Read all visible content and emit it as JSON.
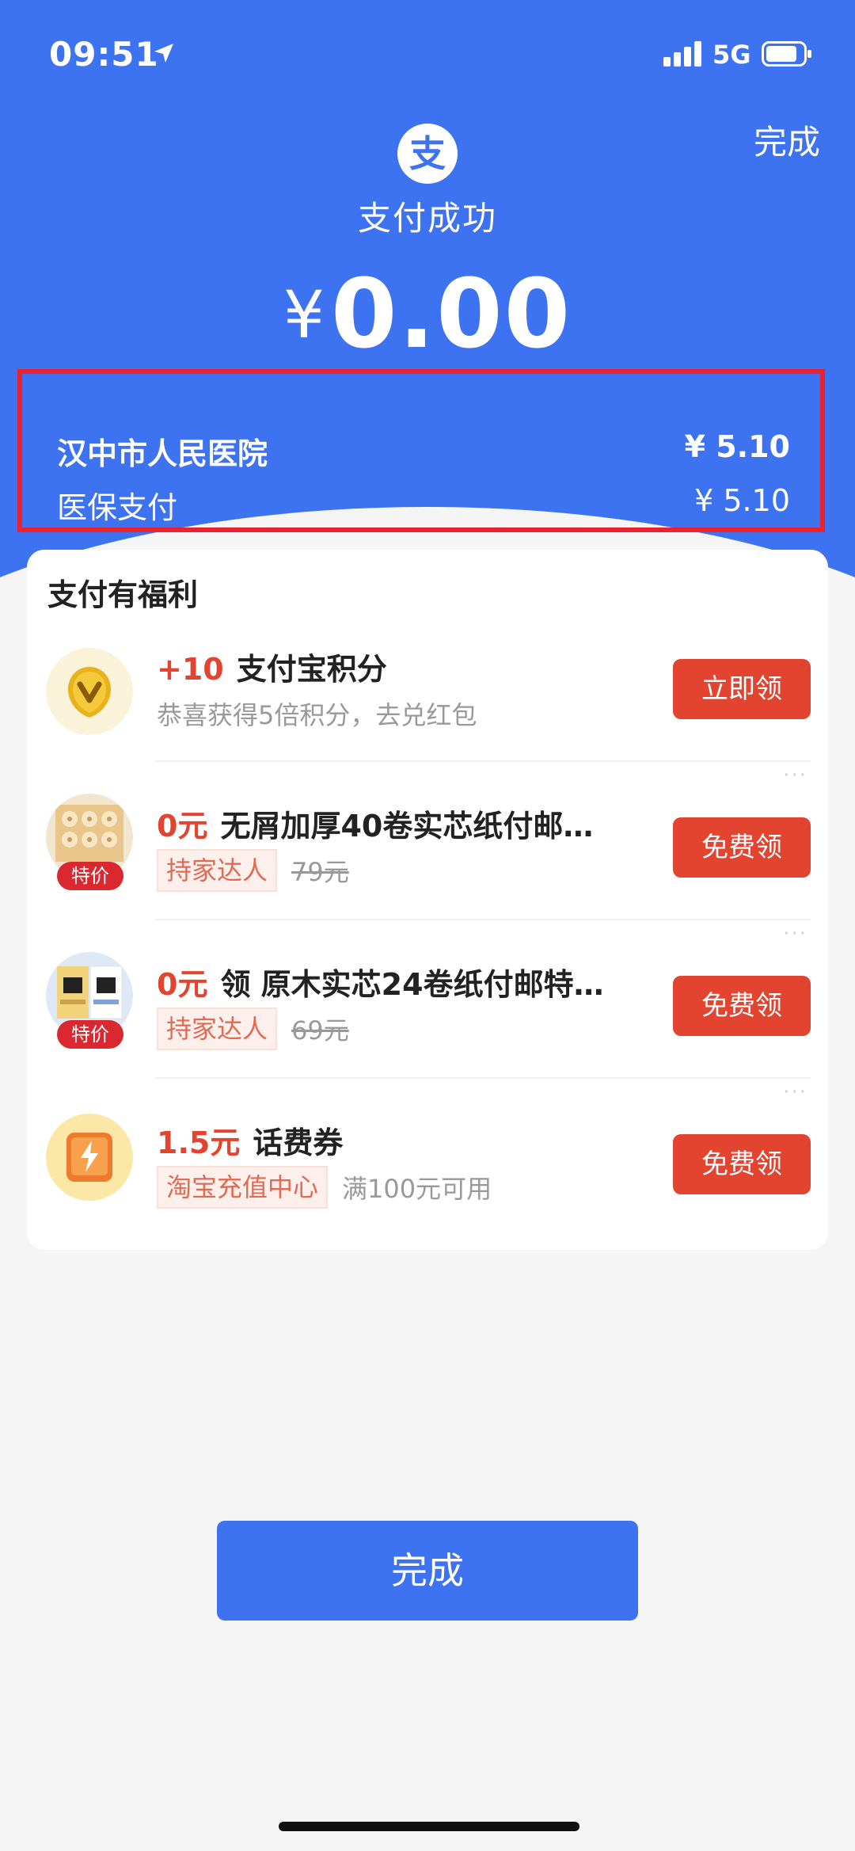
{
  "status_bar": {
    "time": "09:51",
    "network": "5G"
  },
  "header": {
    "done_label": "完成",
    "logo_glyph": "支",
    "title": "支付成功",
    "currency": "¥",
    "amount": "0.00"
  },
  "details": {
    "merchant": "汉中市人民医院",
    "merchant_amount": "¥ 5.10",
    "method": "医保支付",
    "method_amount": "¥ 5.10"
  },
  "benefits": {
    "title": "支付有福利",
    "items": [
      {
        "value": "+10",
        "title": "支付宝积分",
        "subtitle": "恭喜获得5倍积分，去兑红包",
        "button": "立即领",
        "icon": "points-coin-icon"
      },
      {
        "value": "0元",
        "title": "无屑加厚40卷实芯纸付邮…",
        "tag": "持家达人",
        "original_price": "79元",
        "badge": "特价",
        "button": "免费领",
        "more": "···",
        "icon": "tissue-rolls-image"
      },
      {
        "value": "0元",
        "title": "领 原木实芯24卷纸付邮特…",
        "tag": "持家达人",
        "original_price": "69元",
        "badge": "特价",
        "button": "免费领",
        "more": "···",
        "icon": "tissue-pack-image"
      },
      {
        "value": "1.5元",
        "title": "话费券",
        "tag": "淘宝充值中心",
        "note": "满100元可用",
        "button": "免费领",
        "more": "···",
        "icon": "phone-recharge-icon"
      }
    ]
  },
  "footer": {
    "done_label": "完成"
  },
  "colors": {
    "primary_blue": "#3d72f0",
    "accent_red": "#e34430",
    "highlight_border": "#e8232f"
  }
}
